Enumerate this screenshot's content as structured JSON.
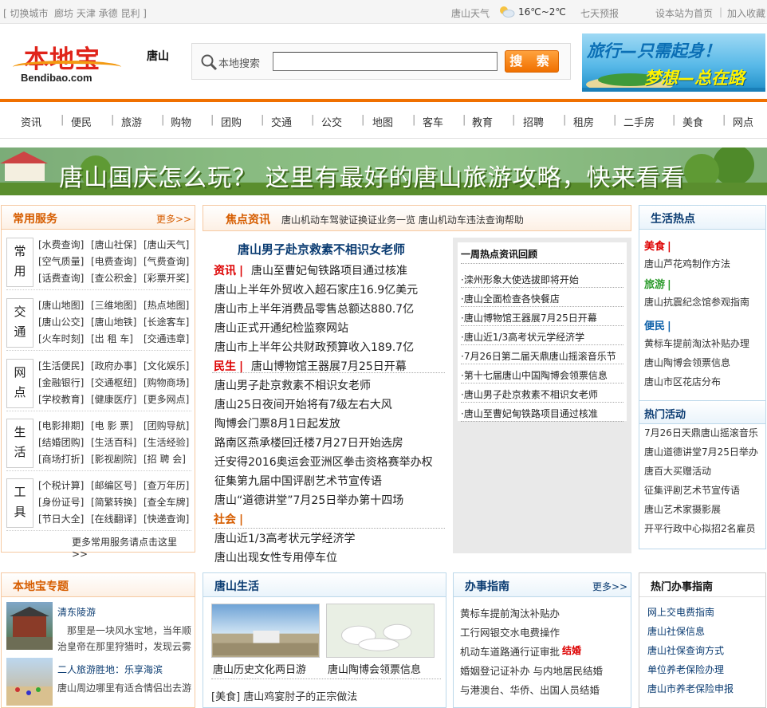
{
  "topbar": {
    "switch_city": "[ 切换城市",
    "nearby_cities": "廊坊 天津 承德 昆利 ]",
    "weather_label": "唐山天气",
    "temperature": "16℃~2℃",
    "forecast": "七天预报",
    "set_home": "设本站为首页",
    "divider": "|",
    "add_favorite": "加入收藏"
  },
  "header": {
    "logo_cn": "本地宝",
    "logo_en": "Bendibao.com",
    "city": "唐山",
    "search_label": "本地搜索",
    "search_placeholder": "",
    "search_button": "搜 索",
    "ad_line1": "旅行—只需起身！",
    "ad_line2": "梦想—总在路上！"
  },
  "nav": [
    "资讯",
    "便民",
    "旅游",
    "购物",
    "团购",
    "交通",
    "公交",
    "地图",
    "客车",
    "教育",
    "招聘",
    "租房",
    "二手房",
    "美食",
    "网点"
  ],
  "banner": {
    "text": "唐山国庆怎么玩？ 这里有最好的唐山旅游攻略，快来看看"
  },
  "services": {
    "title": "常用服务",
    "more": "更多>>",
    "groups": [
      {
        "label": [
          "常",
          "用"
        ],
        "items": [
          "[水费查询]",
          "[唐山社保]",
          "[唐山天气]",
          "[空气质量]",
          "[电费查询]",
          "[气费查询]",
          "[话费查询]",
          "[查公积金]",
          "[彩票开奖]"
        ]
      },
      {
        "label": [
          "交",
          "通"
        ],
        "items": [
          "[唐山地图]",
          "[三维地图]",
          "[热点地图]",
          "[唐山公交]",
          "[唐山地铁]",
          "[长途客车]",
          "[火车时刻]",
          "[出 租 车]",
          "[交通违章]"
        ]
      },
      {
        "label": [
          "网",
          "点"
        ],
        "items": [
          "[生活便民]",
          "[政府办事]",
          "[文化娱乐]",
          "[金融银行]",
          "[交通枢纽]",
          "[购物商场]",
          "[学校教育]",
          "[健康医疗]",
          "[更多网点]"
        ]
      },
      {
        "label": [
          "生",
          "活"
        ],
        "items": [
          "[电影排期]",
          "[电 影 票]",
          "[团购导航]",
          "[结婚团购]",
          "[生活百科]",
          "[生活经验]",
          "[商场打折]",
          "[影视剧院]",
          "[招 聘 会]"
        ]
      },
      {
        "label": [
          "工",
          "具"
        ],
        "items": [
          "[个税计算]",
          "[邮编区号]",
          "[查万年历]",
          "[身份证号]",
          "[简繁转换]",
          "[查全车牌]",
          "[节日大全]",
          "[在线翻译]",
          "[快递查询]"
        ]
      }
    ],
    "footer": "更多常用服务请点击这里 >>"
  },
  "focus": {
    "title": "焦点资讯",
    "ticker": "唐山机动车驾驶证换证业务一览 唐山机动车违法查询帮助",
    "headline": "唐山男子赴京救素不相识女老师",
    "tag_news": "资讯",
    "tag_life": "民生",
    "tag_society": "社会",
    "bar": "|",
    "lines": [
      "唐山至曹妃甸铁路项目通过核准",
      "唐山上半年外贸收入超石家庄16.9亿美元",
      "唐山市上半年消费品零售总额达880.7亿",
      "唐山正式开通纪检监察网站",
      "唐山市上半年公共财政预算收入189.7亿",
      "唐山博物馆王器展7月25日开幕",
      "唐山男子赴京救素不相识女老师",
      "唐山25日夜间开始将有7级左右大风",
      "陶博会门票8月1日起发放",
      "路南区燕承楼回迁楼7月27日开始选房",
      "迁安得2016奥运会亚洲区拳击资格赛举办权",
      "征集第九届中国评剧艺术节宣传语",
      "唐山“道德讲堂”7月25日举办第十四场",
      "唐山近1/3高考状元学经济学",
      "唐山出现女性专用停车位"
    ]
  },
  "weekly": {
    "title": "一周热点资讯回顾",
    "items": [
      "·滦州形象大使选拔即将开始",
      "·唐山全面检查各快餐店",
      "·唐山博物馆王器展7月25日开幕",
      "·唐山近1/3高考状元学经济学",
      "·7月26日第二届天鼎唐山摇滚音乐节",
      "·第十七届唐山中国陶博会领票信息",
      "·唐山男子赴京救素不相识女老师",
      "·唐山至曹妃甸铁路项目通过核准"
    ]
  },
  "life_hot": {
    "title": "生活热点",
    "tag_food": "美食",
    "tag_travel": "旅游",
    "tag_conv": "便民",
    "bar": "|",
    "food": [
      "唐山芦花鸡制作方法"
    ],
    "travel": [
      "唐山抗震纪念馆参观指南"
    ],
    "conv": [
      "黄标车提前淘汰补贴办理",
      "唐山陶博会领票信息",
      "唐山市区花店分布"
    ],
    "events_title": "热门活动",
    "events": [
      "7月26日天鼎唐山摇滚音乐",
      "唐山道德讲堂7月25日举办",
      "唐百大买赠活动",
      "征集评剧艺术节宣传语",
      "唐山艺术家摄影展",
      "开平行政中心拟招2名雇员"
    ]
  },
  "topics": {
    "title": "本地宝专题",
    "items": [
      {
        "title": "清东陵游",
        "desc": "那里是一块风水宝地，当年顺治皇帝在那里狩猎时，发现云雾"
      },
      {
        "title": "二人旅游胜地：乐享海滨",
        "desc": "唐山周边哪里有适合情侣出去游"
      }
    ]
  },
  "tangshan_life": {
    "title": "唐山生活",
    "photos": [
      "唐山历史文化两日游",
      "唐山陶博会领票信息"
    ],
    "line": "[美食] 唐山鸡宴肘子的正宗做法"
  },
  "guide": {
    "title": "办事指南",
    "more": "更多>>",
    "tag_marriage": "结婚",
    "items": [
      "黄标车提前淘汰补贴办",
      "工行网银交水电费操作",
      "机动车道路通行证审批",
      "婚姻登记证补办 与内地居民结婚",
      "与港澳台、华侨、出国人员结婚"
    ]
  },
  "hot_guide": {
    "title": "热门办事指南",
    "items": [
      "网上交电费指南",
      "唐山社保信息",
      "唐山社保查询方式",
      "单位养老保险办理",
      "唐山市养老保险申报"
    ]
  }
}
